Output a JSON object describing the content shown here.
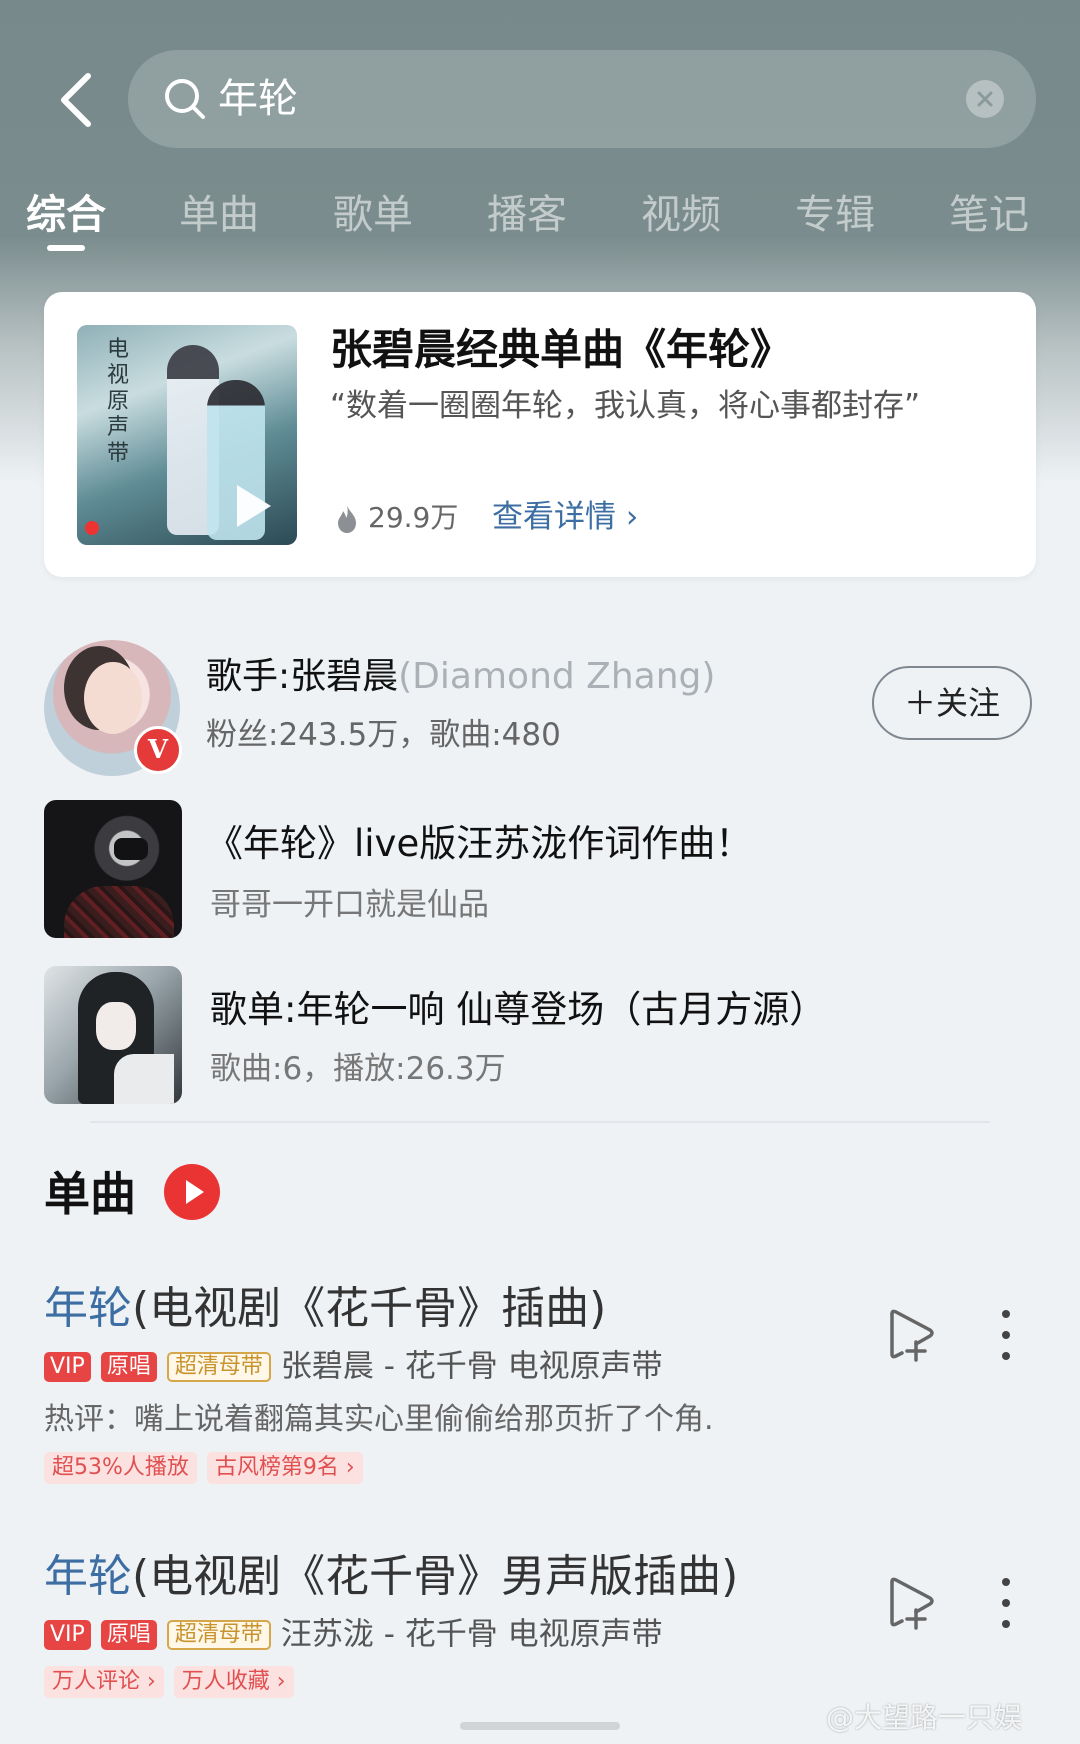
{
  "search": {
    "query": "年轮"
  },
  "tabs": [
    {
      "label": "综合",
      "active": true
    },
    {
      "label": "单曲"
    },
    {
      "label": "歌单"
    },
    {
      "label": "播客"
    },
    {
      "label": "视频"
    },
    {
      "label": "专辑"
    },
    {
      "label": "笔记"
    }
  ],
  "featured": {
    "title": "张碧晨经典单曲《年轮》",
    "quote": "“数着一圈圈年轮，我认真，将心事都封存”",
    "heat": "29.9万",
    "link": "查看详情",
    "cover_text": "电视原声带"
  },
  "artist": {
    "name": "歌手:张碧晨",
    "name_en": "(Diamond Zhang)",
    "meta": "粉丝:243.5万，歌曲:480",
    "badge": "V",
    "follow": "关注"
  },
  "related": [
    {
      "title": "《年轮》live版汪苏泷作词作曲！",
      "sub": "哥哥一开口就是仙品"
    },
    {
      "title": "歌单:年轮一响 仙尊登场（古月方源）",
      "sub": "歌曲:6，播放:26.3万"
    }
  ],
  "singles": {
    "title": "单曲",
    "items": [
      {
        "title_hl": "年轮",
        "title_rest": "(电视剧《花千骨》插曲)",
        "badges": [
          "VIP",
          "原唱",
          "超清母带"
        ],
        "artist": "张碧晨 - 花千骨 电视原声带",
        "comment": "热评：嘴上说着翻篇其实心里偷偷给那页折了个角.",
        "tags": [
          "超53%人播放",
          "古风榜第9名 ›"
        ]
      },
      {
        "title_hl": "年轮",
        "title_rest": "(电视剧《花千骨》男声版插曲)",
        "badges": [
          "VIP",
          "原唱",
          "超清母带"
        ],
        "artist": "汪苏泷 - 花千骨 电视原声带",
        "tags": [
          "万人评论 ›",
          "万人收藏 ›"
        ]
      }
    ]
  },
  "watermark": "@大望路一只娱",
  "colors": {
    "accent_blue": "#3d6ea3",
    "red": "#e74444",
    "header_bg": "#7a8c8d"
  }
}
